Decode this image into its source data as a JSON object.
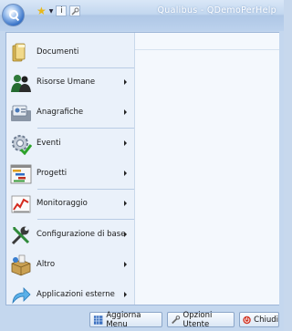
{
  "window": {
    "title": "Qualibus - QDemoPerHelp"
  },
  "qat": {
    "icons": [
      "star-icon",
      "chevron-down-icon",
      "info-icon",
      "tool-icon"
    ]
  },
  "menu": {
    "items": [
      {
        "label": "Documenti",
        "icon": "folder-icon",
        "submenu": false
      },
      {
        "label": "Risorse Umane",
        "icon": "people-icon",
        "submenu": true
      },
      {
        "label": "Anagrafiche",
        "icon": "card-icon",
        "submenu": true
      },
      {
        "label": "Eventi",
        "icon": "gear-check-icon",
        "submenu": true
      },
      {
        "label": "Progetti",
        "icon": "gantt-icon",
        "submenu": true
      },
      {
        "label": "Monitoraggio",
        "icon": "chart-icon",
        "submenu": true
      },
      {
        "label": "Configurazione di base",
        "icon": "wrench-icon",
        "submenu": true
      },
      {
        "label": "Altro",
        "icon": "box-icon",
        "submenu": true
      },
      {
        "label": "Applicazioni esterne",
        "icon": "arrow-icon",
        "submenu": true
      }
    ]
  },
  "footer": {
    "refresh_label": "Aggiorna Menu",
    "options_label": "Opzioni Utente",
    "exit_label": "Chiudi"
  },
  "colors": {
    "accent": "#2f6cc4",
    "frame": "#c4d7ee"
  }
}
